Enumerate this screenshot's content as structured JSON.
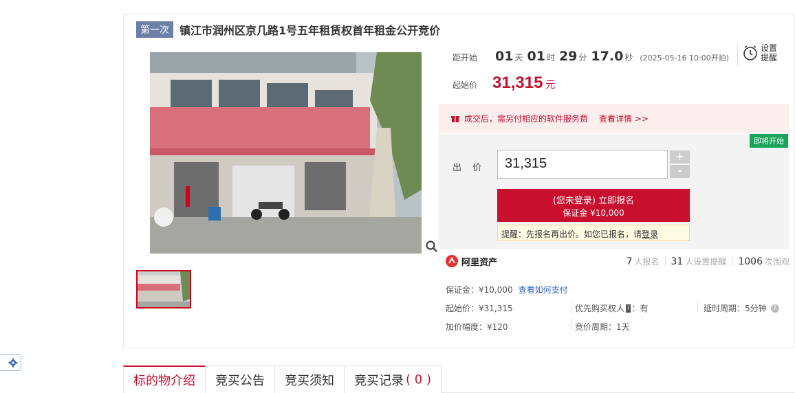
{
  "header": {
    "round_badge": "第一次",
    "title": "镇江市润州区京几路1号五年租赁权首年租金公开竞价"
  },
  "countdown": {
    "label": "距开始",
    "days": "01",
    "days_unit": "天",
    "hours": "01",
    "hours_unit": "时",
    "minutes": "29",
    "minutes_unit": "分",
    "seconds": "17.0",
    "seconds_unit": "秒",
    "start_time": "(2025-05-16 10:00开拍)"
  },
  "reminder": {
    "label": "设置提醒"
  },
  "start_price": {
    "label": "起始价",
    "value": "31,315",
    "unit": "元"
  },
  "notice": {
    "text": "成交后，需另付相应的软件服务费",
    "link": "查看详情 >>"
  },
  "bid": {
    "status_badge": "即将开始",
    "label": "出 价",
    "value": "31,315",
    "plus": "+",
    "minus": "-",
    "signup_line1": "(您未登录) 立即报名",
    "signup_line2": "保证金 ¥10,000",
    "warning_prefix": "提醒：先报名再出价。如您已报名，请",
    "warning_link": "登录"
  },
  "brand": {
    "name": "阿里资产"
  },
  "stats": {
    "signed_count": "7",
    "signed_label": "人报名",
    "reminder_count": "31",
    "reminder_label": "人设置提醒",
    "views_count": "1006",
    "views_label": "次围观"
  },
  "info": {
    "deposit": "保证金：¥10,000",
    "deposit_link": "查看如何支付",
    "start_price": "起始价：¥31,315",
    "priority_label": "优先购买权人",
    "priority_tag": "i",
    "priority_value": "：有",
    "delay": "延时周期：5分钟",
    "increment": "加价幅度：¥120",
    "cycle": "竞价周期：1天"
  },
  "tabs": [
    {
      "label": "标的物介绍"
    },
    {
      "label": "竞买公告"
    },
    {
      "label": "竞买须知"
    },
    {
      "label": "竞买记录",
      "count_open": "(",
      "count": "0",
      "count_close": ")"
    }
  ],
  "colors": {
    "accent": "#c8102e",
    "status_green": "#1aa35a",
    "badge_blue": "#6c7fa6"
  }
}
